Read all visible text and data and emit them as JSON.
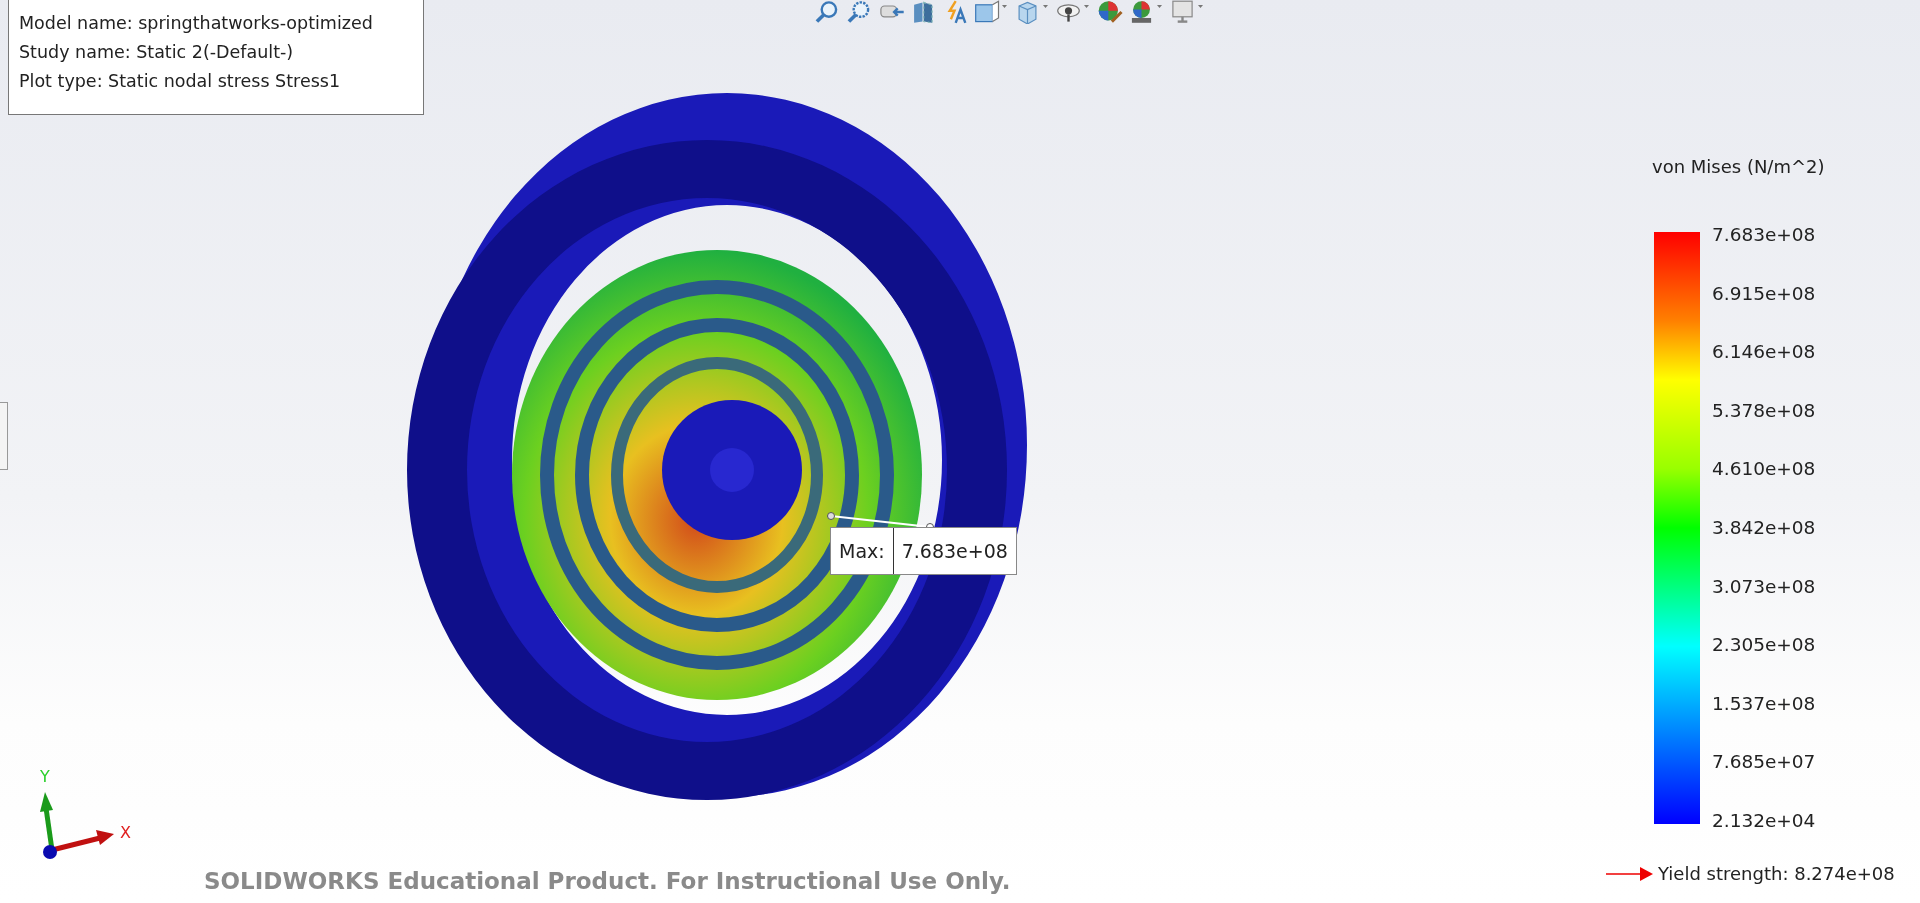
{
  "toolbar": {
    "buttons": [
      {
        "kind": "zoom-fit",
        "dropdown": false
      },
      {
        "kind": "zoom-area",
        "dropdown": false
      },
      {
        "kind": "previous-view",
        "dropdown": false
      },
      {
        "kind": "section",
        "dropdown": false
      },
      {
        "kind": "dynamic-annotation",
        "dropdown": false
      },
      {
        "kind": "view-orientation",
        "dropdown": true
      },
      {
        "kind": "display-style",
        "dropdown": true
      },
      {
        "kind": "hide-show",
        "dropdown": true
      },
      {
        "kind": "edit-appearance",
        "dropdown": false
      },
      {
        "kind": "scene",
        "dropdown": true
      },
      {
        "kind": "view-settings",
        "dropdown": true
      }
    ]
  },
  "info_box": {
    "lines": [
      "Model name: springthatworks-optimized",
      "Study name: Static 2(-Default-)",
      "Plot type: Static nodal stress Stress1"
    ]
  },
  "max_callout": {
    "label": "Max:",
    "value": "7.683e+08"
  },
  "legend": {
    "title": "von Mises (N/m^2)",
    "ticks": [
      "7.683e+08",
      "6.915e+08",
      "6.146e+08",
      "5.378e+08",
      "4.610e+08",
      "3.842e+08",
      "3.073e+08",
      "2.305e+08",
      "1.537e+08",
      "7.685e+07",
      "2.132e+04"
    ],
    "yield": "Yield strength: 8.274e+08"
  },
  "triad": {
    "y_label": "Y",
    "x_label": "X"
  },
  "watermark": "SOLIDWORKS Educational Product. For Instructional Use Only."
}
